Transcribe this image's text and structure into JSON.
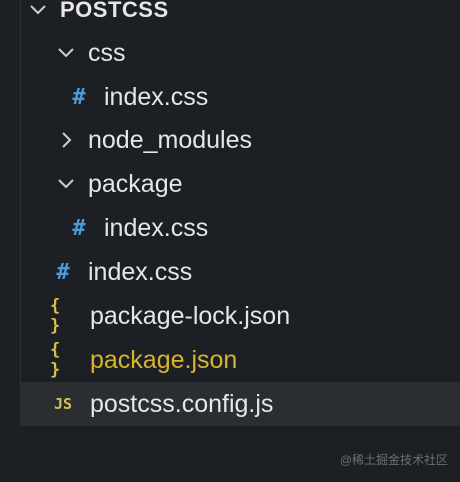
{
  "explorer": {
    "root": {
      "label": "POSTCSS",
      "expanded": true
    },
    "items": [
      {
        "name": "folder-css",
        "label": "css",
        "kind": "folder",
        "expanded": true,
        "icon": "chevron-down-icon"
      },
      {
        "name": "file-css-index",
        "label": "index.css",
        "kind": "file",
        "icon": "css-hash-icon",
        "glyph": "#"
      },
      {
        "name": "folder-node-modules",
        "label": "node_modules",
        "kind": "folder",
        "expanded": false,
        "icon": "chevron-right-icon"
      },
      {
        "name": "folder-package",
        "label": "package",
        "kind": "folder",
        "expanded": true,
        "icon": "chevron-down-icon"
      },
      {
        "name": "file-package-index",
        "label": "index.css",
        "kind": "file",
        "icon": "css-hash-icon",
        "glyph": "#"
      },
      {
        "name": "file-root-index",
        "label": "index.css",
        "kind": "file",
        "icon": "css-hash-icon",
        "glyph": "#"
      },
      {
        "name": "file-package-lock",
        "label": "package-lock.json",
        "kind": "file",
        "icon": "json-braces-icon",
        "glyph": "{ }"
      },
      {
        "name": "file-package-json",
        "label": "package.json",
        "kind": "file",
        "icon": "json-braces-icon",
        "glyph": "{ }",
        "modified": true
      },
      {
        "name": "file-postcss-config",
        "label": "postcss.config.js",
        "kind": "file",
        "icon": "js-icon",
        "glyph": "JS",
        "selected": true
      }
    ]
  },
  "watermark": "@稀土掘金技术社区",
  "colors": {
    "background": "#1c1f24",
    "selected_row": "#2a2d32",
    "text": "#e6e6e6",
    "css_icon": "#4d9ad6",
    "json_js_icon": "#d6c24a",
    "modified_text": "#d7b42f"
  }
}
